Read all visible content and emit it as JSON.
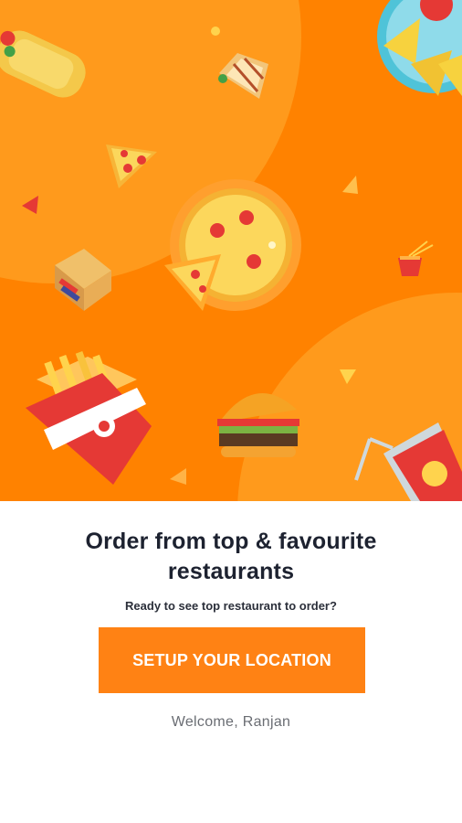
{
  "onboarding": {
    "headline": "Order from top & favourite restaurants",
    "subtext": "Ready to see top restaurant to order?",
    "cta_label": "SETUP YOUR LOCATION",
    "welcome": "Welcome, Ranjan"
  },
  "theme": {
    "brand_orange": "#ff8200",
    "button_orange": "#ff8214",
    "headline_color": "#1d2230",
    "muted_text": "#6a6d73"
  },
  "illustration": {
    "icons": [
      "burrito-icon",
      "sandwich-icon",
      "pizza-slice-icon",
      "nachos-plate-icon",
      "pizza-icon",
      "gift-box-icon",
      "fries-icon",
      "noodle-box-icon",
      "burger-icon",
      "soda-cup-icon"
    ]
  }
}
